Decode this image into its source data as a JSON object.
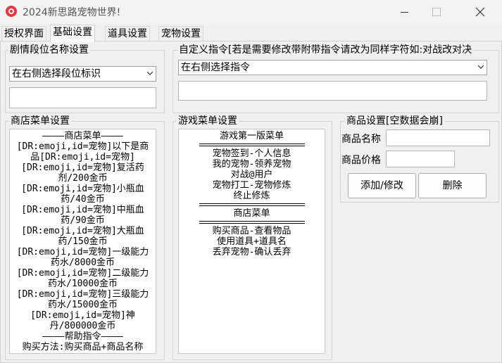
{
  "window": {
    "title": "2024新思路宠物世界!"
  },
  "tabs": [
    "授权界面",
    "基础设置",
    "道具设置",
    "宠物设置"
  ],
  "rank_group": {
    "legend": "剧情段位名称设置",
    "combo_value": "在右侧选择段位标识"
  },
  "command_group": {
    "legend": "自定义指令[若是需要修改带附带指令请改为同样字符如:对战改对决",
    "combo_value": "在右侧选择指令"
  },
  "shop_group": {
    "legend": "商店菜单设置",
    "lines": [
      "————商店菜单————",
      "[DR:emoji,id=宠物]以下是商品[DR:emoji,id=宠物]",
      "[DR:emoji,id=宠物]复活药剂/200金币",
      "[DR:emoji,id=宠物]小瓶血药/40金币",
      "[DR:emoji,id=宠物]中瓶血药/90金币",
      "[DR:emoji,id=宠物]大瓶血药/150金币",
      "[DR:emoji,id=宠物]一级能力药水/8000金币",
      "[DR:emoji,id=宠物]二级能力药水/10000金币",
      "[DR:emoji,id=宠物]三级能力药水/15000金币",
      "[DR:emoji,id=宠物]神丹/800000金币",
      "————帮助指令————",
      "购买方法:购买商品+商品名称"
    ]
  },
  "game_group": {
    "legend": "游戏菜单设置",
    "title1": "游戏第一版菜单",
    "block1": [
      "宠物签到-个人信息",
      "我的宠物-领养宠物",
      "对战@用户",
      "宠物打工-宠物修炼",
      "终止修炼"
    ],
    "title2": "商店菜单",
    "block2": [
      "购买商品-查看物品",
      "使用道具+道具名",
      "丢弃宠物-确认丢弃"
    ]
  },
  "item_group": {
    "legend": "商品设置[空数据会崩]",
    "name_label": "商品名称",
    "price_label": "商品价格",
    "add_button": "添加/修改",
    "delete_button": "删除"
  }
}
